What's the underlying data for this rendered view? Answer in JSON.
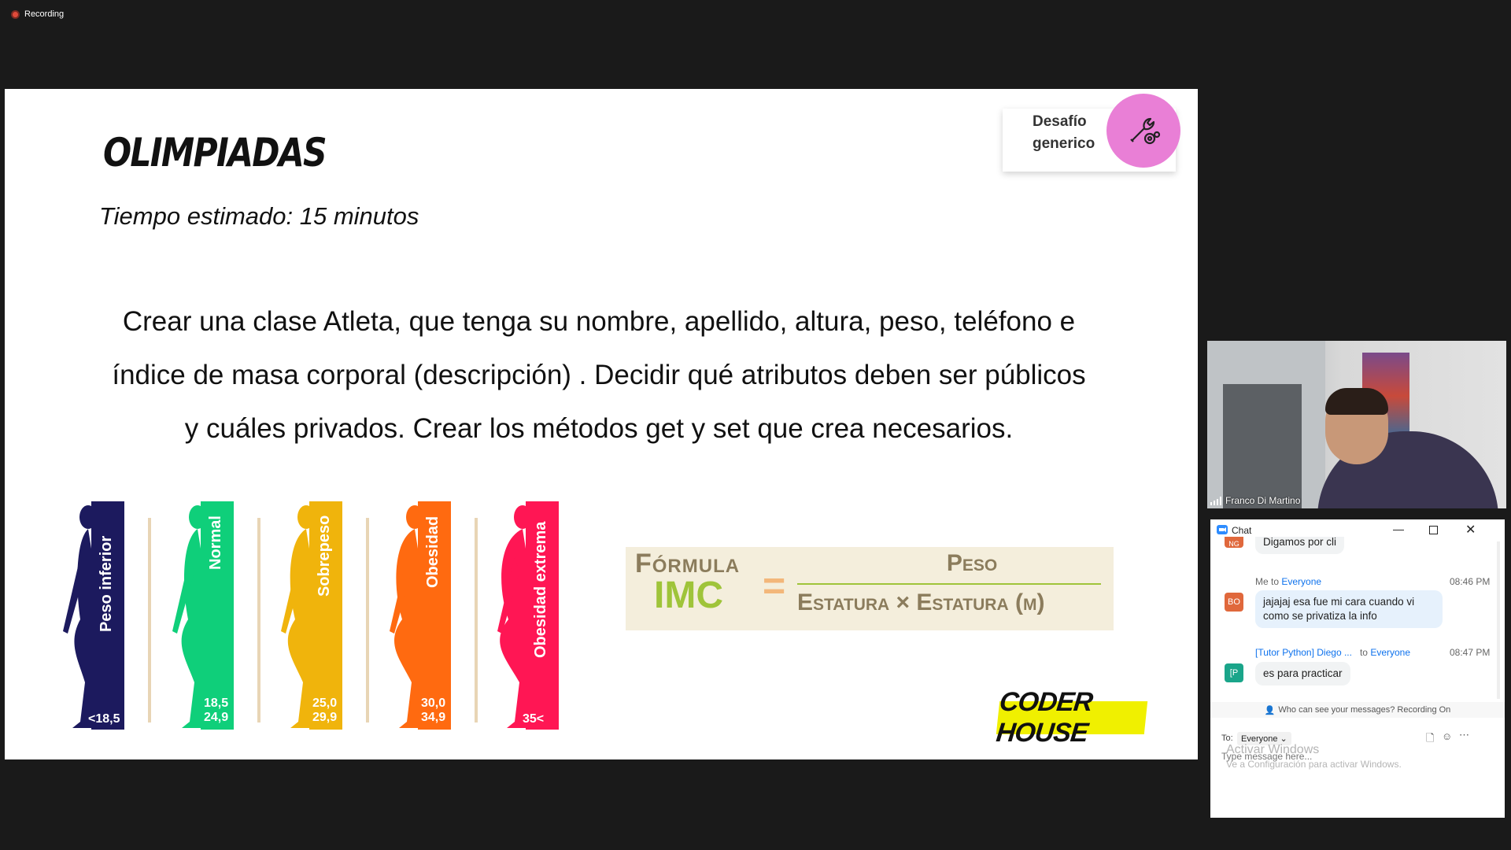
{
  "recording": {
    "label": "Recording"
  },
  "slide": {
    "title": "OLIMPIADAS",
    "time": "Tiempo estimado: 15 minutos",
    "body_lines": [
      "Crear una clase Atleta, que tenga su nombre, apellido, altura,  peso, teléfono e",
      "índice de masa corporal (descripción) . Decidir qué atributos deben ser públicos",
      "y cuáles privados. Crear los métodos get y set que crea necesarios."
    ],
    "badge": {
      "line1": "Desafío",
      "line2": "generico",
      "icon": "tools-gear-icon"
    },
    "bmi": [
      {
        "label": "Peso inferior",
        "range1": "<18,5",
        "range2": "",
        "color": "#1c1a5e"
      },
      {
        "label": "Normal",
        "range1": "18,5",
        "range2": "24,9",
        "color": "#0fcf7a"
      },
      {
        "label": "Sobrepeso",
        "range1": "25,0",
        "range2": "29,9",
        "color": "#f0b40c"
      },
      {
        "label": "Obesidad",
        "range1": "30,0",
        "range2": "34,9",
        "color": "#ff6a10"
      },
      {
        "label": "Obesidad extrema",
        "range1": "35<",
        "range2": "",
        "color": "#ff1654"
      }
    ],
    "formula": {
      "word1": "Fórmula",
      "word2": "IMC",
      "equals": "=",
      "numerator": "Peso",
      "denominator": "Estatura × Estatura (m)"
    },
    "logo": "CODER HOUSE"
  },
  "video": {
    "name": "Franco Di Martino"
  },
  "chat": {
    "title": "Chat",
    "messages": [
      {
        "avatar": "NG",
        "color": "#e0683c",
        "text": "Digamos por cli"
      },
      {
        "avatar": "BO",
        "color": "#e0683c",
        "from": "Me to",
        "to": "Everyone",
        "time": "08:46 PM",
        "text": "jajajaj esa fue mi cara cuando vi como se privatiza la info"
      },
      {
        "avatar": "[P",
        "color": "#1aa58a",
        "from": "[Tutor Python] Diego ...",
        "to_prefix": "to",
        "to": "Everyone",
        "time": "08:47 PM",
        "text": "es para practicar"
      }
    ],
    "privacy": "Who can see your messages? Recording On",
    "to_label": "To:",
    "to_value": "Everyone",
    "placeholder": "Type message here...",
    "watermark1": "Activar Windows",
    "watermark2": "Ve a Configuración para activar Windows."
  }
}
